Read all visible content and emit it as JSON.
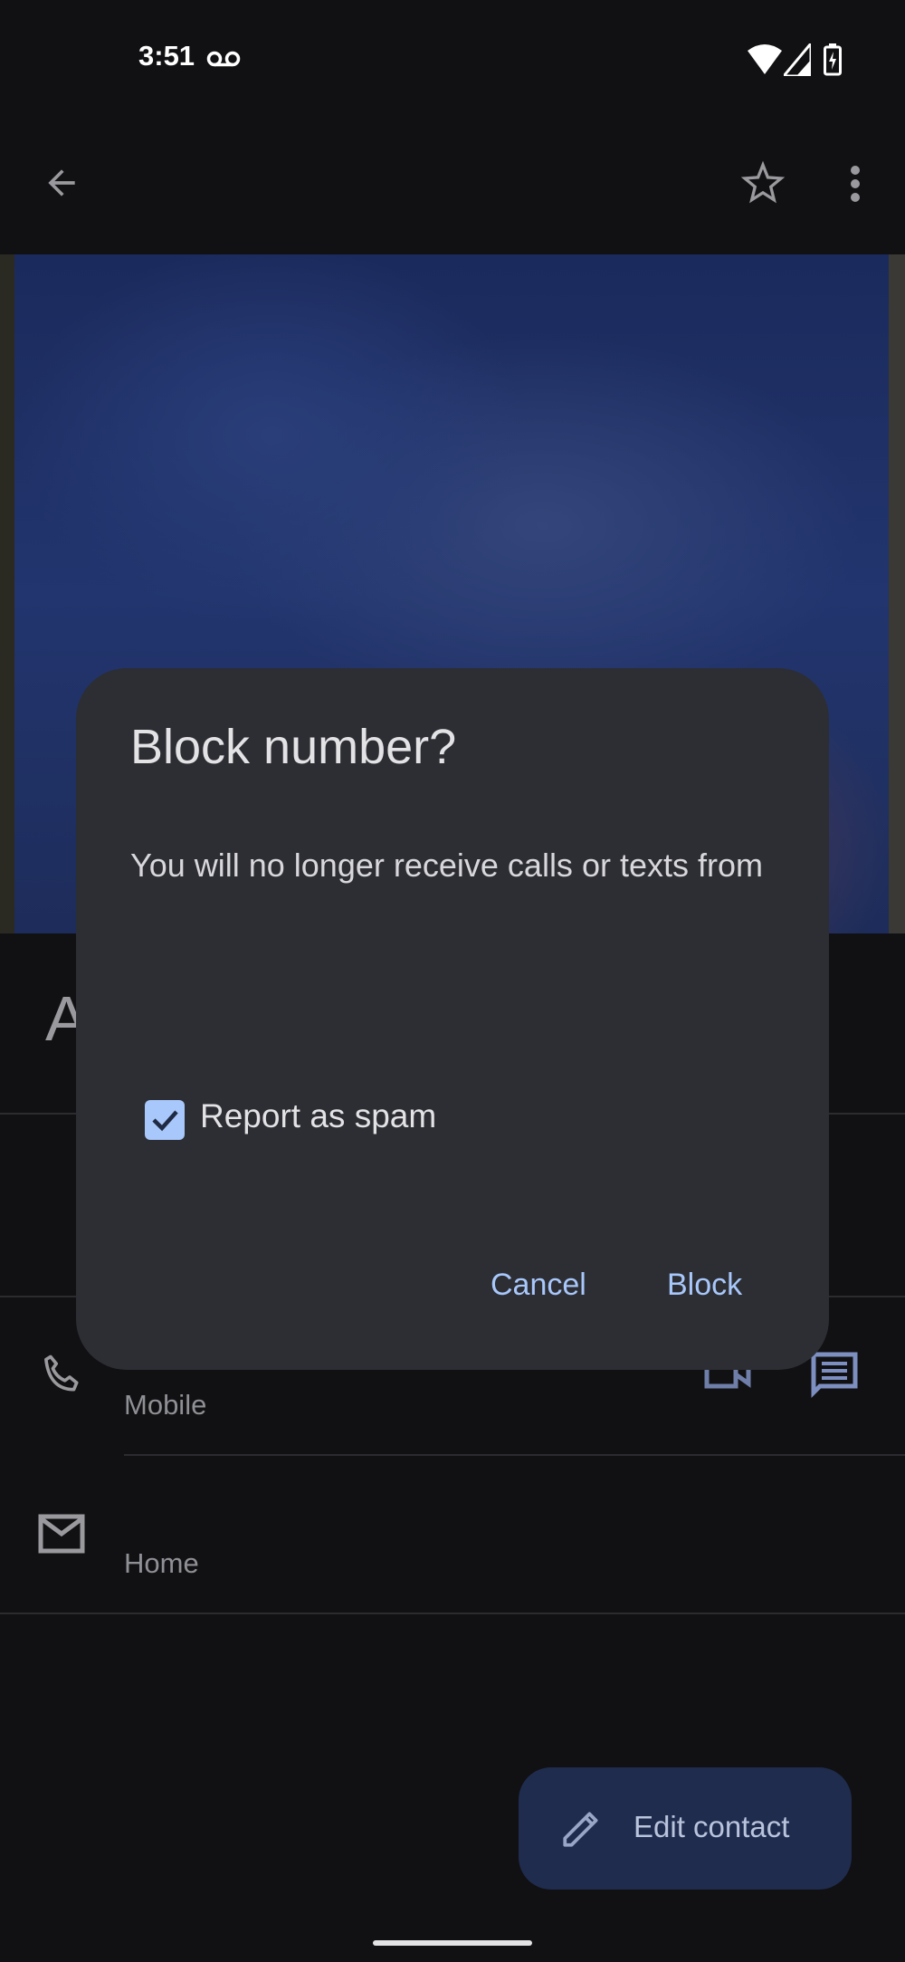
{
  "status_bar": {
    "time": "3:51",
    "icons": [
      "voicemail-icon",
      "wifi-icon",
      "signal-icon",
      "battery-charging-icon"
    ]
  },
  "app_bar": {
    "icons": [
      "back-arrow-icon",
      "star-outline-icon",
      "more-vert-icon"
    ]
  },
  "contact": {
    "name_initial": "A",
    "phone_label": "Mobile",
    "email_label": "Home"
  },
  "dialog": {
    "title": "Block number?",
    "body": "You will no longer receive calls or texts from",
    "checkbox_label": "Report as spam",
    "checkbox_checked": true,
    "cancel": "Cancel",
    "confirm": "Block"
  },
  "fab": {
    "label": "Edit contact",
    "icon": "pencil-icon"
  },
  "colors": {
    "accent": "#a8c7fa",
    "dialog_bg": "#2d2e33",
    "background": "#111113",
    "fab_bg": "#1f2c4e"
  }
}
